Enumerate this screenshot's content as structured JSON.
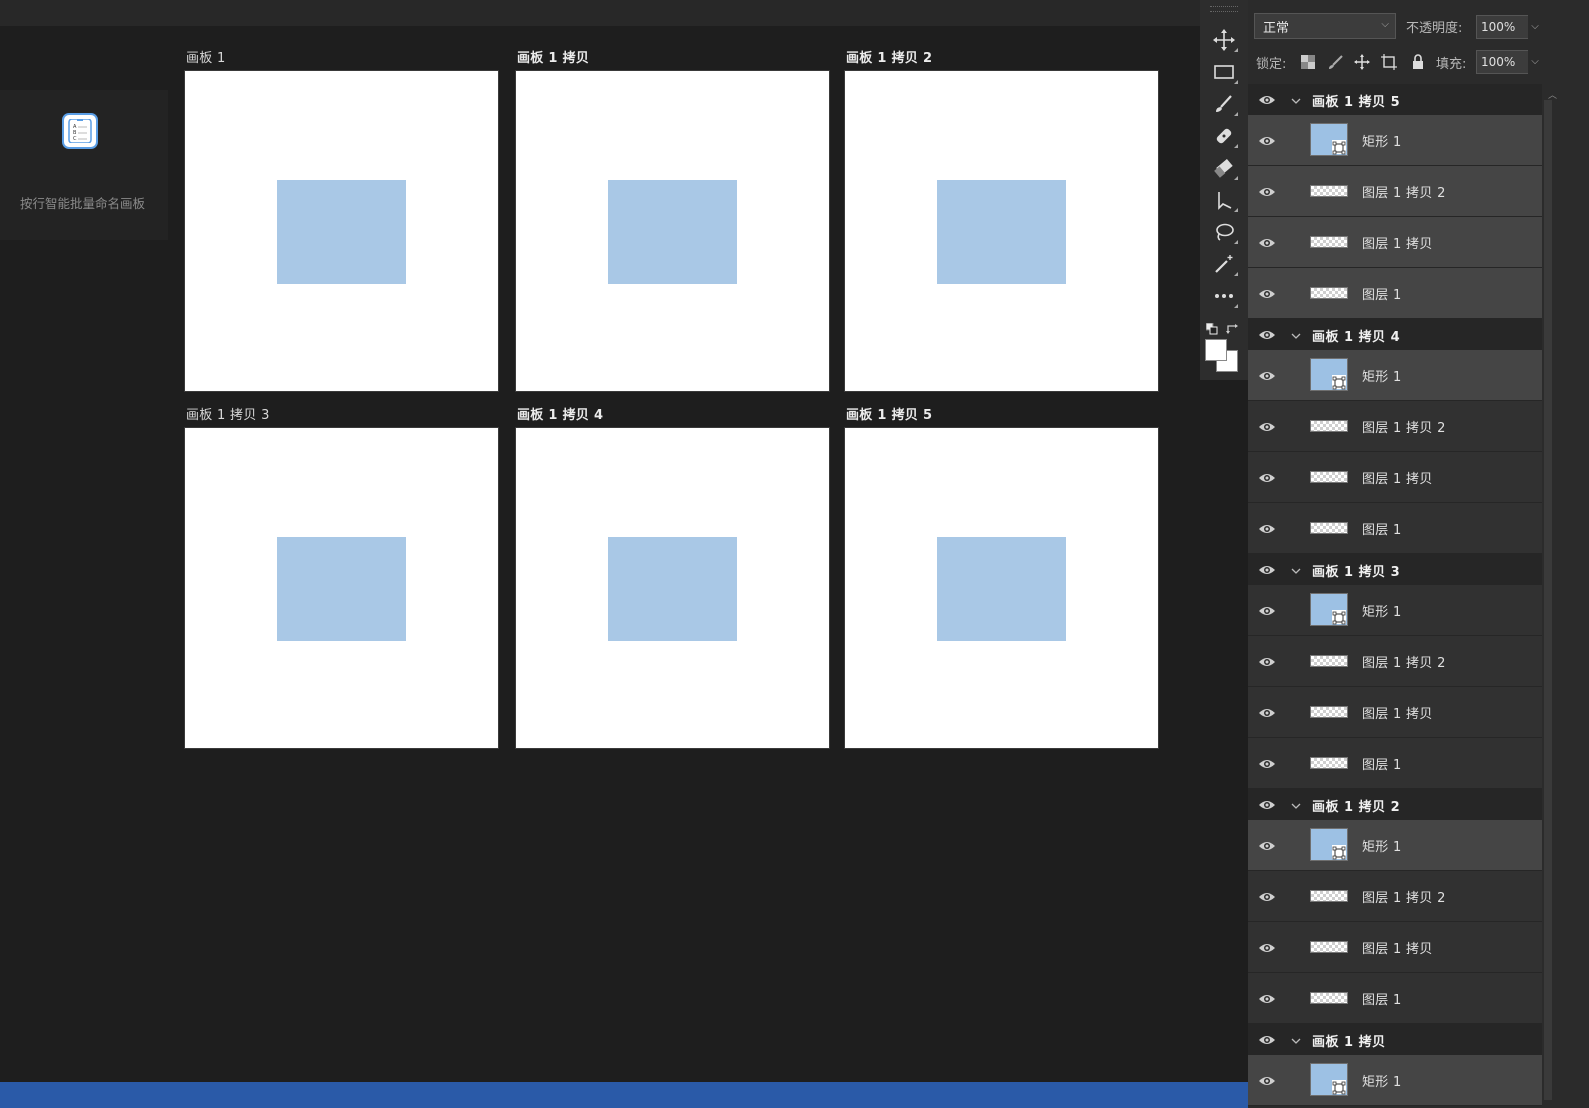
{
  "action_panel": {
    "label": "按行智能批量命名画板",
    "icon": "list-rename-icon"
  },
  "artboards": [
    {
      "label": "画板 1",
      "bold": false,
      "rect_color": "#a9c8e6"
    },
    {
      "label": "画板 1 拷贝",
      "bold": true,
      "rect_color": "#a9c8e6"
    },
    {
      "label": "画板 1 拷贝 2",
      "bold": true,
      "rect_color": "#a9c8e6"
    },
    {
      "label": "画板 1 拷贝 3",
      "bold": false,
      "rect_color": "#a9c8e6"
    },
    {
      "label": "画板 1 拷贝 4",
      "bold": true,
      "rect_color": "#a9c8e6"
    },
    {
      "label": "画板 1 拷贝 5",
      "bold": true,
      "rect_color": "#a9c8e6"
    }
  ],
  "toolbar": {
    "tools": [
      "move-tool-icon",
      "rectangle-marquee-icon",
      "brush-icon",
      "healing-brush-icon",
      "eraser-icon",
      "path-selection-icon",
      "lasso-icon",
      "magic-wand-icon",
      "more-tools-icon"
    ],
    "swatch_foreground": "#ffffff",
    "swatch_background": "#ffffff"
  },
  "layers_panel": {
    "blend_mode": "正常",
    "opacity_label": "不透明度:",
    "opacity_value": "100%",
    "lock_label": "锁定:",
    "fill_label": "填充:",
    "fill_value": "100%",
    "rows": [
      {
        "type": "group",
        "name": "画板 1 拷贝 5"
      },
      {
        "type": "shape",
        "name": "矩形 1",
        "selected": true
      },
      {
        "type": "pixel",
        "name": "图层 1 拷贝 2",
        "selected": true
      },
      {
        "type": "pixel",
        "name": "图层 1 拷贝",
        "selected": true
      },
      {
        "type": "pixel",
        "name": "图层 1",
        "selected": true
      },
      {
        "type": "group",
        "name": "画板 1 拷贝 4"
      },
      {
        "type": "shape",
        "name": "矩形 1",
        "selected": true
      },
      {
        "type": "pixel",
        "name": "图层 1 拷贝 2",
        "selected": false
      },
      {
        "type": "pixel",
        "name": "图层 1 拷贝",
        "selected": false
      },
      {
        "type": "pixel",
        "name": "图层 1",
        "selected": false
      },
      {
        "type": "group",
        "name": "画板 1 拷贝 3"
      },
      {
        "type": "shape",
        "name": "矩形 1",
        "selected": false
      },
      {
        "type": "pixel",
        "name": "图层 1 拷贝 2",
        "selected": false
      },
      {
        "type": "pixel",
        "name": "图层 1 拷贝",
        "selected": false
      },
      {
        "type": "pixel",
        "name": "图层 1",
        "selected": false
      },
      {
        "type": "group",
        "name": "画板 1 拷贝 2"
      },
      {
        "type": "shape",
        "name": "矩形 1",
        "selected": true
      },
      {
        "type": "pixel",
        "name": "图层 1 拷贝 2",
        "selected": false
      },
      {
        "type": "pixel",
        "name": "图层 1 拷贝",
        "selected": false
      },
      {
        "type": "pixel",
        "name": "图层 1",
        "selected": false
      },
      {
        "type": "group",
        "name": "画板 1 拷贝"
      },
      {
        "type": "shape",
        "name": "矩形 1",
        "selected": true
      }
    ]
  },
  "colors": {
    "accent_bar": "#2a5aa8",
    "shape_thumb": "#9dc1e4"
  }
}
